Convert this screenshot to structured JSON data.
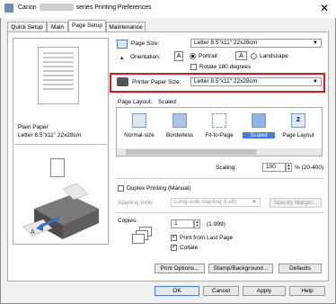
{
  "window": {
    "title_prefix": "Canon",
    "title_suffix": "series Printing Preferences",
    "close_glyph": "✕"
  },
  "tabs": [
    {
      "label": "Quick Setup"
    },
    {
      "label": "Main"
    },
    {
      "label": "Page Setup"
    },
    {
      "label": "Maintenance"
    }
  ],
  "preview": {
    "media_type": "Plain Paper",
    "size_label": "Letter 8.5\"x11\" 22x28cm"
  },
  "page_size": {
    "label": "Page Size:",
    "value": "Letter 8.5\"x11\" 22x28cm"
  },
  "orientation": {
    "label": "Orientation:",
    "portrait": "Portrait",
    "landscape": "Landscape",
    "rotate": "Rotate 180 degrees"
  },
  "printer_paper_size": {
    "label": "Printer Paper Size:",
    "value": "Letter 8.5\"x11\" 22x28cm"
  },
  "page_layout": {
    "label": "Page Layout:",
    "current": "Scaled",
    "items": [
      "Normal-size",
      "Borderless",
      "Fit-to-Page",
      "Scaled",
      "Page Layout"
    ]
  },
  "scaling": {
    "label": "Scaling:",
    "value": "100",
    "range": "% (20-400)"
  },
  "duplex": {
    "label": "Duplex Printing (Manual)",
    "stapling_label": "Stapling Side:",
    "stapling_value": "Long-side stapling (Left)",
    "specify_margin": "Specify Margin..."
  },
  "copies": {
    "label": "Copies:",
    "value": "1",
    "range": "(1-999)",
    "print_last": "Print from Last Page",
    "collate": "Collate"
  },
  "buttons": {
    "print_options": "Print Options...",
    "stamp_background": "Stamp/Background...",
    "defaults": "Defaults",
    "ok": "OK",
    "cancel": "Cancel",
    "apply": "Apply",
    "help": "Help"
  },
  "colors": {
    "highlight": "#d8181c",
    "selection": "#3b7fd6"
  }
}
